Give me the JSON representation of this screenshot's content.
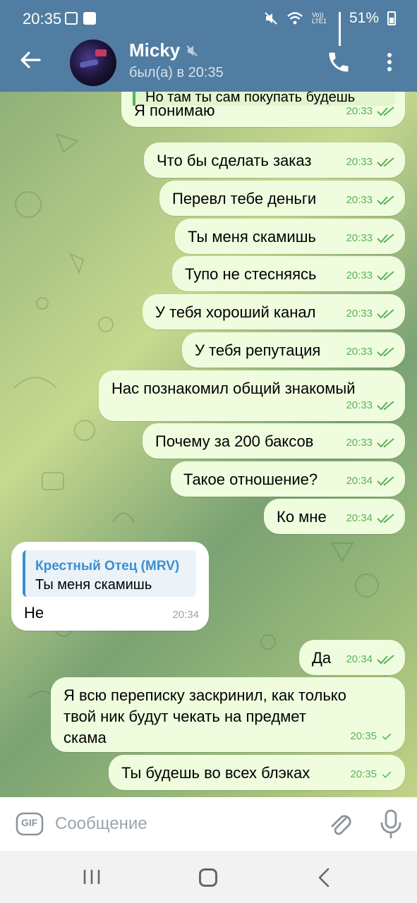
{
  "status_bar": {
    "time": "20:35",
    "signal_label": "Vo)) LTE1",
    "battery": "51%"
  },
  "header": {
    "contact_name": "Micky",
    "last_seen": "был(а) в 20:35",
    "muted": true,
    "icons": [
      "back-arrow-icon",
      "phone-icon",
      "more-vert-icon",
      "mute-icon"
    ]
  },
  "messages": [
    {
      "dir": "out",
      "text": "Я понимаю",
      "time": "20:33",
      "quote": "Но там ты сам покупать  будешь",
      "read": true
    },
    {
      "dir": "out",
      "text": "Что бы сделать заказ",
      "time": "20:33",
      "read": true
    },
    {
      "dir": "out",
      "text": "Перевл тебе деньги",
      "time": "20:33",
      "read": true
    },
    {
      "dir": "out",
      "text": "Ты меня скамишь",
      "time": "20:33",
      "read": true
    },
    {
      "dir": "out",
      "text": "Тупо не стесняясь",
      "time": "20:33",
      "read": true
    },
    {
      "dir": "out",
      "text": "У тебя хороший канал",
      "time": "20:33",
      "read": true
    },
    {
      "dir": "out",
      "text": "У тебя репутация",
      "time": "20:33",
      "read": true
    },
    {
      "dir": "out",
      "text": "Нас познакомил общий знакомый",
      "time": "20:33",
      "read": true
    },
    {
      "dir": "out",
      "text": "Почему за 200 баксов",
      "time": "20:33",
      "read": true
    },
    {
      "dir": "out",
      "text": "Такое отношение?",
      "time": "20:34",
      "read": true
    },
    {
      "dir": "out",
      "text": "Ко мне",
      "time": "20:34",
      "read": true
    },
    {
      "dir": "in",
      "text": "Не",
      "time": "20:34",
      "reply_name": "Крестный Отец (MRV)",
      "reply_text": "Ты меня скамишь"
    },
    {
      "dir": "out",
      "text": "Да",
      "time": "20:34",
      "read": true
    },
    {
      "dir": "out",
      "lines": [
        "Я всю переписку заскринил, как только",
        "твой ник будут чекать на предмет",
        "скама"
      ],
      "time": "20:35",
      "read": false
    },
    {
      "dir": "out",
      "text": "Ты будешь во всех блэках",
      "time": "20:35",
      "read": false
    }
  ],
  "input": {
    "placeholder": "Сообщение",
    "gif_label": "GIF"
  },
  "colors": {
    "header": "#517da2",
    "outgoing_bubble": "#effdde",
    "incoming_bubble": "#ffffff",
    "tick": "#5ab25b",
    "reply_accent": "#3a8fd2"
  }
}
